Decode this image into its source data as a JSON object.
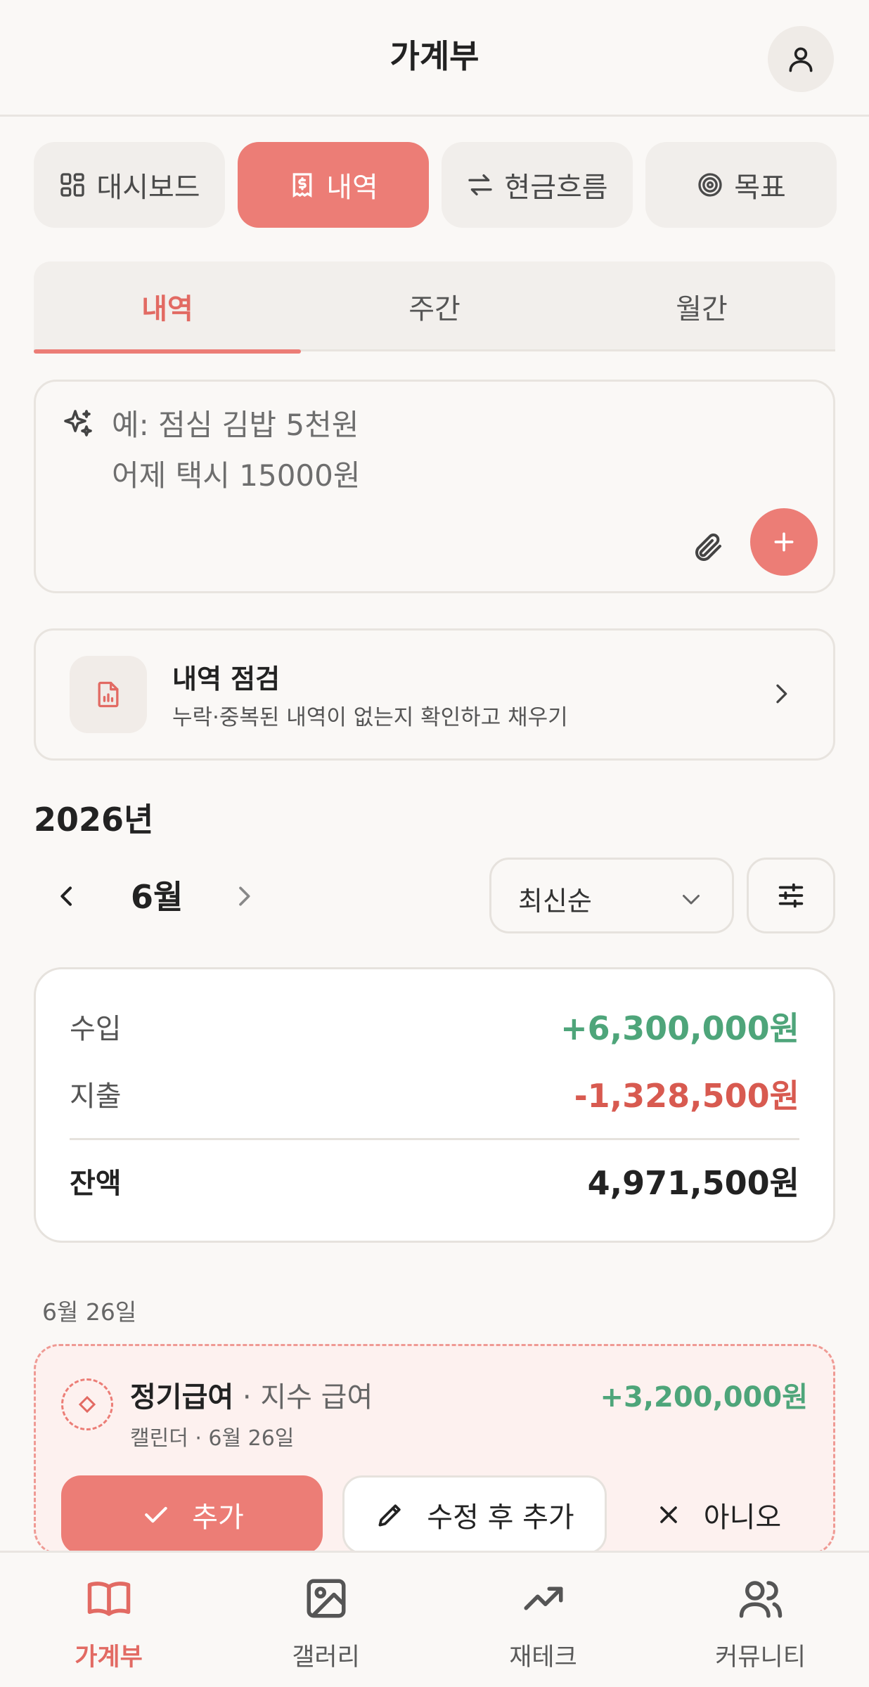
{
  "header": {
    "title": "가계부"
  },
  "top_tabs": [
    {
      "label": "대시보드",
      "icon": "grid-icon"
    },
    {
      "label": "내역",
      "icon": "receipt-icon",
      "active": true
    },
    {
      "label": "현금흐름",
      "icon": "arrows-swap-icon"
    },
    {
      "label": "목표",
      "icon": "target-icon"
    }
  ],
  "sub_tabs": [
    {
      "label": "내역",
      "active": true
    },
    {
      "label": "주간"
    },
    {
      "label": "월간"
    }
  ],
  "quick_input": {
    "placeholder": "예: 점심 김밥 5천원\n어제 택시 15000원"
  },
  "review_card": {
    "title": "내역 점검",
    "description": "누락·중복된 내역이 없는지 확인하고 채우기"
  },
  "period": {
    "year": "2026년",
    "month": "6월",
    "sort": "최신순"
  },
  "summary": {
    "income_label": "수입",
    "income_value": "+6,300,000원",
    "expense_label": "지출",
    "expense_value": "-1,328,500원",
    "balance_label": "잔액",
    "balance_value": "4,971,500원"
  },
  "day_group": {
    "date": "6월 26일"
  },
  "pending_item": {
    "title": "정기급여",
    "separator": " · ",
    "subtitle": "지수 급여",
    "meta": "캘린더 · 6월 26일",
    "amount": "+3,200,000원",
    "confirm_label": "추가",
    "edit_label": "수정 후 추가",
    "reject_label": "아니오"
  },
  "bottom_nav": [
    {
      "label": "가계부",
      "icon": "book-icon",
      "active": true
    },
    {
      "label": "갤러리",
      "icon": "image-icon"
    },
    {
      "label": "재테크",
      "icon": "trending-up-icon"
    },
    {
      "label": "커뮤니티",
      "icon": "users-icon"
    }
  ],
  "colors": {
    "accent": "#ec7d76",
    "income": "#4ea57a",
    "expense": "#d85a50",
    "background": "#faf8f6"
  }
}
